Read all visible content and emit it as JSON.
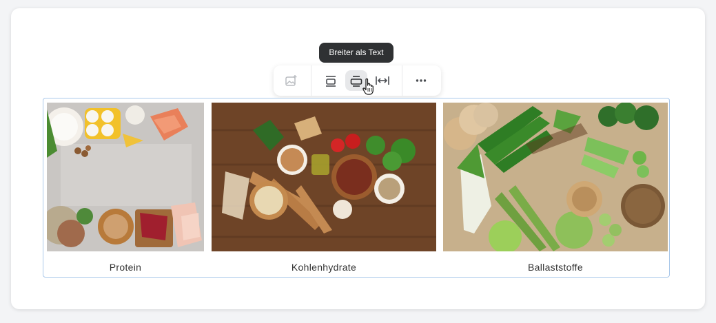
{
  "tooltip": {
    "text": "Breiter als Text"
  },
  "toolbar": {
    "buttons": [
      {
        "name": "add-image",
        "icon": "image-plus-icon",
        "active": false,
        "enabled": false
      },
      {
        "name": "align-inline",
        "icon": "align-inline-icon",
        "active": false
      },
      {
        "name": "wider-than-text",
        "icon": "wider-than-text-icon",
        "active": true
      },
      {
        "name": "full-width",
        "icon": "full-width-icon",
        "active": false
      },
      {
        "name": "more",
        "icon": "more-horizontal-icon",
        "active": false
      }
    ]
  },
  "gallery": {
    "items": [
      {
        "caption": "Protein",
        "image": "protein-foods-photo"
      },
      {
        "caption": "Kohlenhydrate",
        "image": "carbohydrate-foods-photo"
      },
      {
        "caption": "Ballaststoffe",
        "image": "fiber-foods-photo"
      }
    ]
  },
  "colors": {
    "tooltip_bg": "#2f3133",
    "gallery_border": "#a9c8ea",
    "active_button_bg": "#e7e8ea"
  }
}
